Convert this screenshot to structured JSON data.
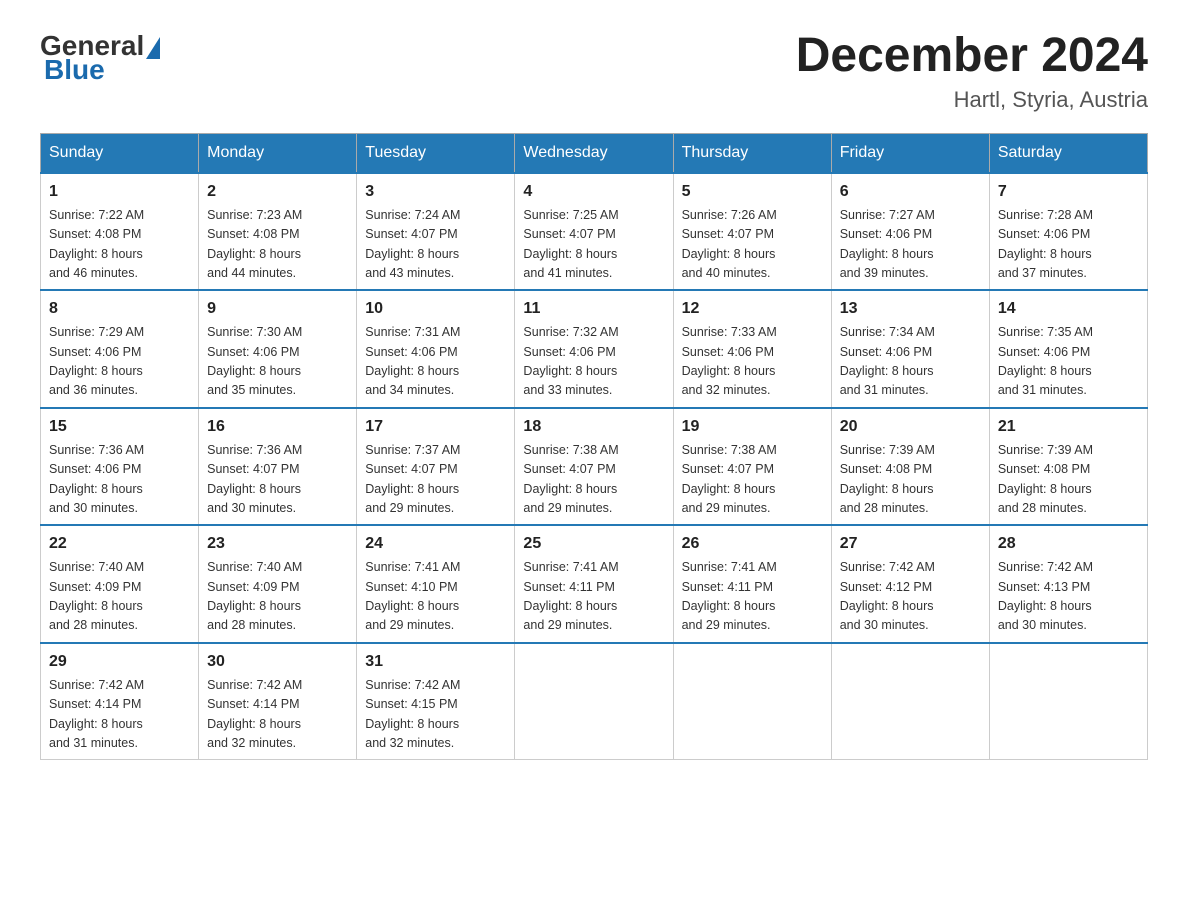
{
  "header": {
    "logo": {
      "general": "General",
      "blue": "Blue"
    },
    "title": "December 2024",
    "location": "Hartl, Styria, Austria"
  },
  "days_of_week": [
    "Sunday",
    "Monday",
    "Tuesday",
    "Wednesday",
    "Thursday",
    "Friday",
    "Saturday"
  ],
  "weeks": [
    [
      {
        "day": "1",
        "sunrise": "7:22 AM",
        "sunset": "4:08 PM",
        "daylight": "8 hours and 46 minutes."
      },
      {
        "day": "2",
        "sunrise": "7:23 AM",
        "sunset": "4:08 PM",
        "daylight": "8 hours and 44 minutes."
      },
      {
        "day": "3",
        "sunrise": "7:24 AM",
        "sunset": "4:07 PM",
        "daylight": "8 hours and 43 minutes."
      },
      {
        "day": "4",
        "sunrise": "7:25 AM",
        "sunset": "4:07 PM",
        "daylight": "8 hours and 41 minutes."
      },
      {
        "day": "5",
        "sunrise": "7:26 AM",
        "sunset": "4:07 PM",
        "daylight": "8 hours and 40 minutes."
      },
      {
        "day": "6",
        "sunrise": "7:27 AM",
        "sunset": "4:06 PM",
        "daylight": "8 hours and 39 minutes."
      },
      {
        "day": "7",
        "sunrise": "7:28 AM",
        "sunset": "4:06 PM",
        "daylight": "8 hours and 37 minutes."
      }
    ],
    [
      {
        "day": "8",
        "sunrise": "7:29 AM",
        "sunset": "4:06 PM",
        "daylight": "8 hours and 36 minutes."
      },
      {
        "day": "9",
        "sunrise": "7:30 AM",
        "sunset": "4:06 PM",
        "daylight": "8 hours and 35 minutes."
      },
      {
        "day": "10",
        "sunrise": "7:31 AM",
        "sunset": "4:06 PM",
        "daylight": "8 hours and 34 minutes."
      },
      {
        "day": "11",
        "sunrise": "7:32 AM",
        "sunset": "4:06 PM",
        "daylight": "8 hours and 33 minutes."
      },
      {
        "day": "12",
        "sunrise": "7:33 AM",
        "sunset": "4:06 PM",
        "daylight": "8 hours and 32 minutes."
      },
      {
        "day": "13",
        "sunrise": "7:34 AM",
        "sunset": "4:06 PM",
        "daylight": "8 hours and 31 minutes."
      },
      {
        "day": "14",
        "sunrise": "7:35 AM",
        "sunset": "4:06 PM",
        "daylight": "8 hours and 31 minutes."
      }
    ],
    [
      {
        "day": "15",
        "sunrise": "7:36 AM",
        "sunset": "4:06 PM",
        "daylight": "8 hours and 30 minutes."
      },
      {
        "day": "16",
        "sunrise": "7:36 AM",
        "sunset": "4:07 PM",
        "daylight": "8 hours and 30 minutes."
      },
      {
        "day": "17",
        "sunrise": "7:37 AM",
        "sunset": "4:07 PM",
        "daylight": "8 hours and 29 minutes."
      },
      {
        "day": "18",
        "sunrise": "7:38 AM",
        "sunset": "4:07 PM",
        "daylight": "8 hours and 29 minutes."
      },
      {
        "day": "19",
        "sunrise": "7:38 AM",
        "sunset": "4:07 PM",
        "daylight": "8 hours and 29 minutes."
      },
      {
        "day": "20",
        "sunrise": "7:39 AM",
        "sunset": "4:08 PM",
        "daylight": "8 hours and 28 minutes."
      },
      {
        "day": "21",
        "sunrise": "7:39 AM",
        "sunset": "4:08 PM",
        "daylight": "8 hours and 28 minutes."
      }
    ],
    [
      {
        "day": "22",
        "sunrise": "7:40 AM",
        "sunset": "4:09 PM",
        "daylight": "8 hours and 28 minutes."
      },
      {
        "day": "23",
        "sunrise": "7:40 AM",
        "sunset": "4:09 PM",
        "daylight": "8 hours and 28 minutes."
      },
      {
        "day": "24",
        "sunrise": "7:41 AM",
        "sunset": "4:10 PM",
        "daylight": "8 hours and 29 minutes."
      },
      {
        "day": "25",
        "sunrise": "7:41 AM",
        "sunset": "4:11 PM",
        "daylight": "8 hours and 29 minutes."
      },
      {
        "day": "26",
        "sunrise": "7:41 AM",
        "sunset": "4:11 PM",
        "daylight": "8 hours and 29 minutes."
      },
      {
        "day": "27",
        "sunrise": "7:42 AM",
        "sunset": "4:12 PM",
        "daylight": "8 hours and 30 minutes."
      },
      {
        "day": "28",
        "sunrise": "7:42 AM",
        "sunset": "4:13 PM",
        "daylight": "8 hours and 30 minutes."
      }
    ],
    [
      {
        "day": "29",
        "sunrise": "7:42 AM",
        "sunset": "4:14 PM",
        "daylight": "8 hours and 31 minutes."
      },
      {
        "day": "30",
        "sunrise": "7:42 AM",
        "sunset": "4:14 PM",
        "daylight": "8 hours and 32 minutes."
      },
      {
        "day": "31",
        "sunrise": "7:42 AM",
        "sunset": "4:15 PM",
        "daylight": "8 hours and 32 minutes."
      },
      null,
      null,
      null,
      null
    ]
  ],
  "labels": {
    "sunrise": "Sunrise:",
    "sunset": "Sunset:",
    "daylight": "Daylight:"
  }
}
